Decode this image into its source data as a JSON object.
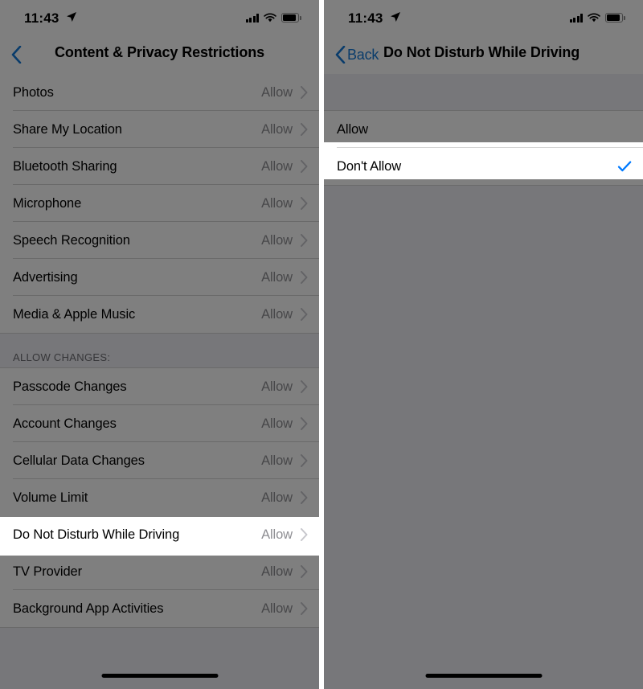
{
  "meta": {
    "accent_blue": "#007AFF",
    "dim_overlay": "rgba(0,0,0,0.50)",
    "list_bg": "#efeff4",
    "value_gray": "#8e8e93"
  },
  "left_phone": {
    "status_bar": {
      "time": "11:43",
      "location_icon": "location-arrow-icon",
      "cellular_icon": "cellular-bars-icon",
      "wifi_icon": "wifi-icon",
      "battery_icon": "battery-icon"
    },
    "nav": {
      "back_icon": "chevron-left-icon",
      "back_label": "",
      "title": "Content & Privacy Restrictions"
    },
    "rows_top": [
      {
        "label": "Photos",
        "value": "Allow"
      },
      {
        "label": "Share My Location",
        "value": "Allow"
      },
      {
        "label": "Bluetooth Sharing",
        "value": "Allow"
      },
      {
        "label": "Microphone",
        "value": "Allow"
      },
      {
        "label": "Speech Recognition",
        "value": "Allow"
      },
      {
        "label": "Advertising",
        "value": "Allow"
      },
      {
        "label": "Media & Apple Music",
        "value": "Allow"
      }
    ],
    "section_header": "ALLOW CHANGES:",
    "rows_bottom": [
      {
        "label": "Passcode Changes",
        "value": "Allow"
      },
      {
        "label": "Account Changes",
        "value": "Allow"
      },
      {
        "label": "Cellular Data Changes",
        "value": "Allow"
      },
      {
        "label": "Volume Limit",
        "value": "Allow"
      },
      {
        "label": "Do Not Disturb While Driving",
        "value": "Allow"
      },
      {
        "label": "TV Provider",
        "value": "Allow"
      },
      {
        "label": "Background App Activities",
        "value": "Allow"
      }
    ],
    "highlighted_row": "Do Not Disturb While Driving"
  },
  "right_phone": {
    "status_bar": {
      "time": "11:43",
      "location_icon": "location-arrow-icon",
      "cellular_icon": "cellular-bars-icon",
      "wifi_icon": "wifi-icon",
      "battery_icon": "battery-icon"
    },
    "nav": {
      "back_icon": "chevron-left-icon",
      "back_label": "Back",
      "title": "Do Not Disturb While Driving"
    },
    "options": [
      {
        "label": "Allow",
        "selected": false
      },
      {
        "label": "Don't Allow",
        "selected": true
      }
    ],
    "highlighted_row": "Don't Allow",
    "checkmark_icon": "checkmark-icon"
  }
}
